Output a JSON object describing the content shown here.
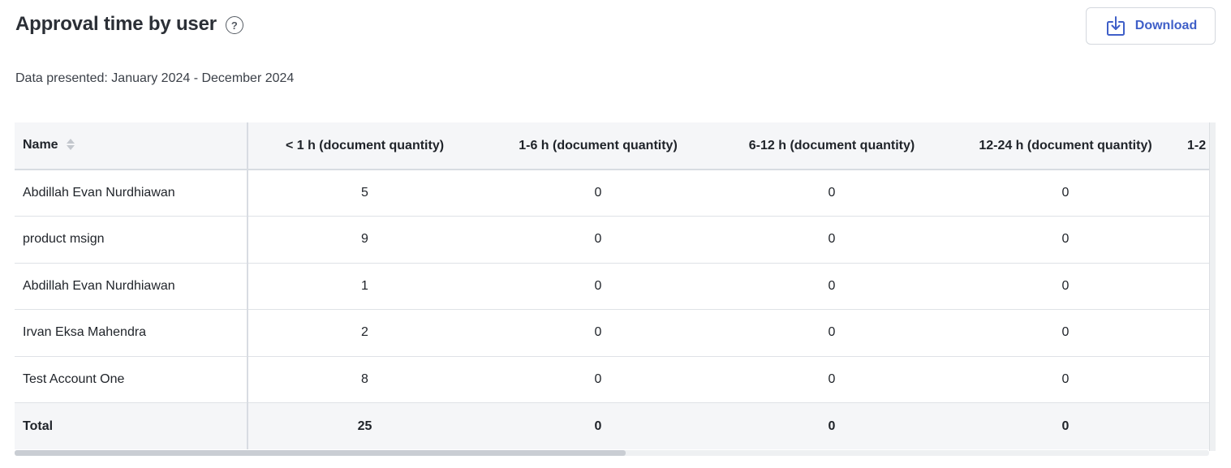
{
  "header": {
    "title": "Approval time by user",
    "help_icon": "question-circle-icon",
    "download_label": "Download",
    "download_icon": "download-tray-icon"
  },
  "subtitle": "Data presented: January 2024 - December 2024",
  "table": {
    "columns": [
      "Name",
      "< 1 h (document quantity)",
      "1-6 h (document quantity)",
      "6-12 h (document quantity)",
      "12-24 h (document quantity)",
      "1-2"
    ],
    "rows": [
      {
        "name": "Abdillah Evan Nurdhiawan",
        "values": [
          "5",
          "0",
          "0",
          "0"
        ]
      },
      {
        "name": "product msign",
        "values": [
          "9",
          "0",
          "0",
          "0"
        ]
      },
      {
        "name": "Abdillah Evan Nurdhiawan",
        "values": [
          "1",
          "0",
          "0",
          "0"
        ]
      },
      {
        "name": "Irvan Eksa Mahendra",
        "values": [
          "2",
          "0",
          "0",
          "0"
        ]
      },
      {
        "name": "Test Account One",
        "values": [
          "8",
          "0",
          "0",
          "0"
        ]
      }
    ],
    "total": {
      "name": "Total",
      "values": [
        "25",
        "0",
        "0",
        "0"
      ]
    }
  },
  "colors": {
    "accent": "#3f5fc8",
    "header_bg": "#f5f6f8",
    "border": "#dfe2e6"
  }
}
